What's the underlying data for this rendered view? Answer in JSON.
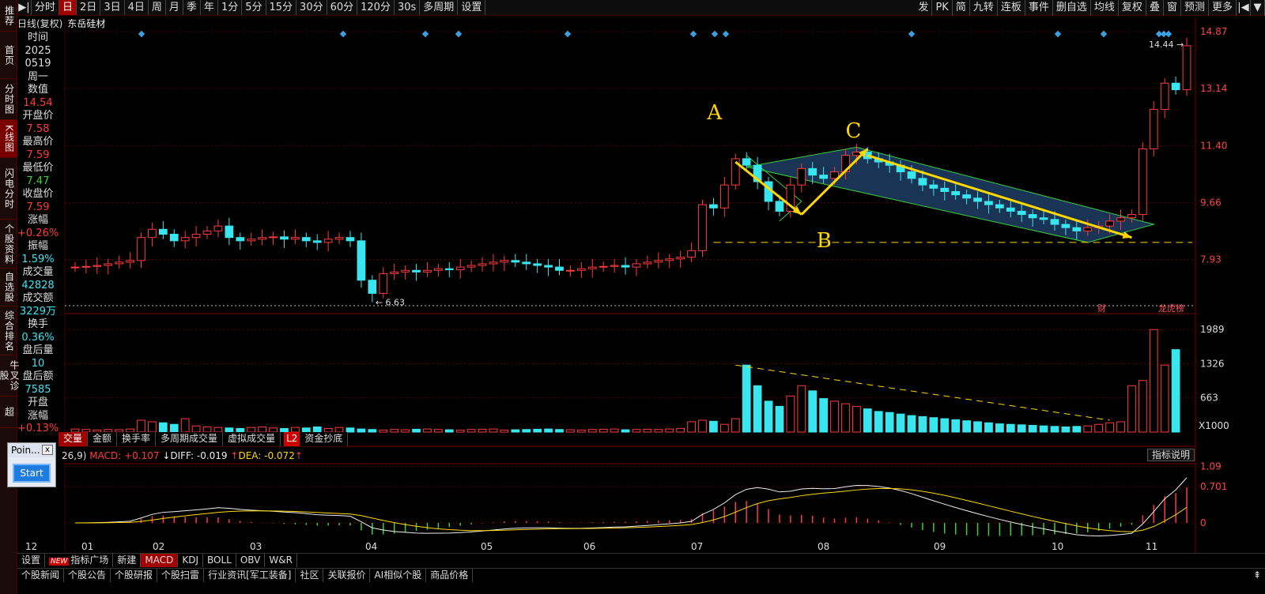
{
  "nav": [
    "推荐",
    "首页",
    "分时图",
    "K线图",
    "闪电分时",
    "个股资料",
    "自选股",
    "综合排名",
    "牛叉诊股",
    "超"
  ],
  "nav_active": 3,
  "nav_new_badge": "NEW",
  "toolbar": {
    "left": [
      "分时",
      "日",
      "2日",
      "3日",
      "4日",
      "周",
      "月",
      "季",
      "年",
      "1分",
      "5分",
      "15分",
      "30分",
      "60分",
      "120分",
      "30s",
      "多周期",
      "设置"
    ],
    "active": "日",
    "right": [
      "发",
      "PK",
      "简",
      "九转",
      "连板",
      "事件",
      "删自选",
      "均线",
      "复权",
      "叠",
      "窗",
      "预测",
      "更多"
    ]
  },
  "stock": {
    "period": "日线(复权)",
    "name": "东岳硅材"
  },
  "info": [
    {
      "label": "时间",
      "value": "2025",
      "color": "lbl"
    },
    {
      "label": "",
      "value": "0519",
      "color": "lbl"
    },
    {
      "label": "",
      "value": "周一",
      "color": "lbl"
    },
    {
      "label": "数值",
      "value": "14.54",
      "color": "red"
    },
    {
      "label": "开盘价",
      "value": "7.58",
      "color": "red"
    },
    {
      "label": "最高价",
      "value": "7.59",
      "color": "red"
    },
    {
      "label": "最低价",
      "value": "7.47",
      "color": "grn"
    },
    {
      "label": "收盘价",
      "value": "7.59",
      "color": "red"
    },
    {
      "label": "涨幅",
      "value": "+0.26%",
      "color": "red"
    },
    {
      "label": "振幅",
      "value": "1.59%",
      "color": "cyan"
    },
    {
      "label": "成交量",
      "value": "42828",
      "color": "cyan"
    },
    {
      "label": "成交额",
      "value": "3229万",
      "color": "cyan"
    },
    {
      "label": "换手",
      "value": "0.36%",
      "color": "cyan"
    },
    {
      "label": "盘后量",
      "value": "10",
      "color": "cyan"
    },
    {
      "label": "盘后额",
      "value": "7585",
      "color": "cyan"
    },
    {
      "label": "开盘",
      "value": "",
      "color": "lbl"
    },
    {
      "label": "涨幅",
      "value": "+0.13%",
      "color": "red"
    }
  ],
  "price_axis": [
    "14.87",
    "13.14",
    "11.40",
    "9.66",
    "7.93"
  ],
  "vol_axis": [
    "1989",
    "1326",
    "663"
  ],
  "vol_unit": "X1000",
  "macd_axis": [
    "1.09",
    "0.701",
    "0"
  ],
  "months": [
    "12",
    "01",
    "02",
    "03",
    "04",
    "05",
    "06",
    "07",
    "08",
    "09",
    "10",
    "11"
  ],
  "annotations": {
    "A": "A",
    "B": "B",
    "C": "C",
    "low": "6.63",
    "high": "14.44",
    "fin": "财",
    "rank": "龙虎榜"
  },
  "vol_tabs": [
    "交量",
    "金额",
    "换手率",
    "多周期成交量",
    "虚拟成交量",
    "L2",
    "资金抄底"
  ],
  "macd_head": {
    "params": "26,9)",
    "macd": "MACD: +0.107",
    "diff": "DIFF: -0.019",
    "dea": "DEA: -0.072"
  },
  "ind_btn": "指标说明",
  "bottom1": [
    "设置",
    "指标广场",
    "新建",
    "MACD",
    "KDJ",
    "BOLL",
    "OBV",
    "W&R"
  ],
  "bottom1_active": "MACD",
  "bottom2": [
    "个股新闻",
    "个股公告",
    "个股研报",
    "个股扫雷",
    "行业资讯[军工装备]",
    "社区",
    "关联报价",
    "AI相似个股",
    "商品价格"
  ],
  "popup": {
    "title": "Poin...",
    "close": "x",
    "start": "Start"
  },
  "colors": {
    "up": "#ff3b3b",
    "down": "#39e6f0",
    "bg": "#000000",
    "grid": "#5a0000",
    "channel": "#1d3d63"
  },
  "chart_data": {
    "type": "candlestick",
    "title": "日线(复权) 东岳硅材",
    "ylim": [
      6.5,
      14.87
    ],
    "x_months": [
      "12",
      "01",
      "02",
      "03",
      "04",
      "05",
      "06",
      "07",
      "08",
      "09",
      "10",
      "11"
    ],
    "close_series_estimated": [
      7.7,
      7.72,
      7.75,
      7.8,
      7.85,
      7.9,
      8.6,
      8.85,
      8.7,
      8.5,
      8.6,
      8.7,
      8.8,
      8.95,
      8.6,
      8.5,
      8.55,
      8.6,
      8.62,
      8.55,
      8.6,
      8.5,
      8.45,
      8.55,
      8.6,
      8.5,
      7.3,
      6.9,
      7.5,
      7.55,
      7.6,
      7.55,
      7.6,
      7.65,
      7.62,
      7.7,
      7.75,
      7.8,
      7.85,
      7.9,
      7.85,
      7.8,
      7.75,
      7.7,
      7.6,
      7.6,
      7.65,
      7.7,
      7.72,
      7.75,
      7.7,
      7.8,
      7.85,
      7.9,
      7.95,
      8.0,
      8.2,
      9.6,
      9.5,
      10.2,
      11.0,
      10.8,
      10.3,
      9.7,
      9.4,
      10.2,
      10.7,
      10.5,
      10.4,
      10.6,
      11.1,
      11.2,
      11.0,
      10.9,
      10.8,
      10.6,
      10.4,
      10.2,
      10.1,
      10.0,
      9.9,
      9.8,
      9.7,
      9.6,
      9.5,
      9.4,
      9.3,
      9.2,
      9.15,
      9.0,
      8.9,
      8.8,
      8.9,
      8.95,
      9.1,
      9.2,
      9.3,
      11.3,
      12.5,
      13.3,
      13.1,
      14.44
    ],
    "volume_k_estimated": [
      60,
      50,
      40,
      50,
      45,
      60,
      230,
      200,
      180,
      150,
      260,
      120,
      100,
      90,
      80,
      70,
      90,
      100,
      80,
      70,
      90,
      80,
      100,
      70,
      90,
      80,
      60,
      50,
      40,
      50,
      45,
      55,
      60,
      50,
      45,
      40,
      50,
      55,
      60,
      40,
      45,
      50,
      55,
      60,
      50,
      45,
      40,
      50,
      55,
      60,
      45,
      50,
      55,
      50,
      60,
      70,
      200,
      230,
      210,
      150,
      260,
      1300,
      900,
      600,
      500,
      700,
      900,
      800,
      650,
      600,
      550,
      500,
      450,
      400,
      380,
      350,
      320,
      300,
      280,
      260,
      240,
      220,
      200,
      180,
      160,
      150,
      140,
      130,
      120,
      110,
      100,
      110,
      120,
      150,
      180,
      200,
      900,
      1000,
      1989,
      1300,
      1600
    ],
    "channel": {
      "upper_start": [
        10.8,
        11.4
      ],
      "lower_end": [
        8.4,
        9.0
      ]
    },
    "support_B": 8.45
  }
}
